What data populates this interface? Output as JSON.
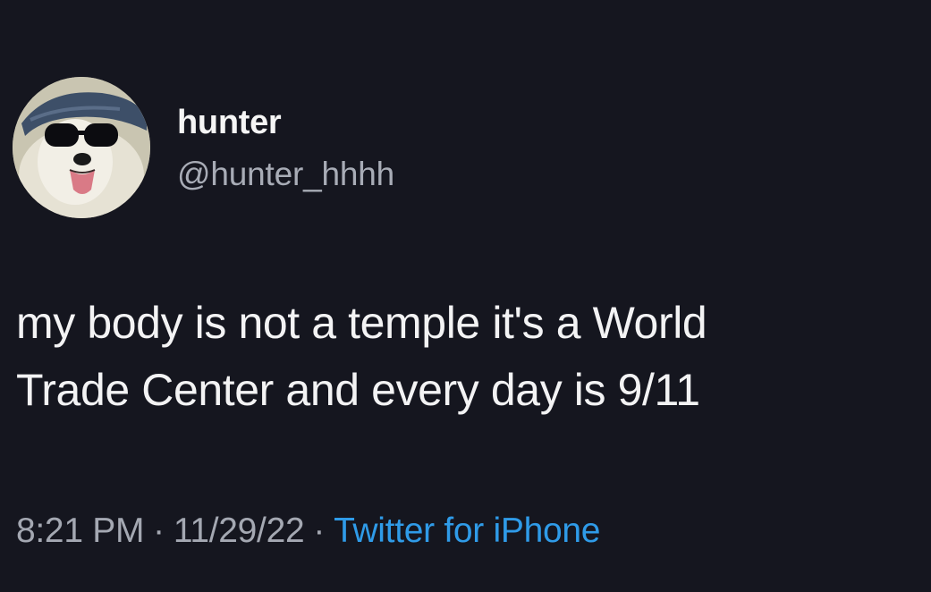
{
  "tweet": {
    "author": {
      "display_name": "hunter",
      "handle": "@hunter_hhhh",
      "avatar": "dog-with-cap-and-sunglasses"
    },
    "text_lines": [
      "my body is not a temple it's a World",
      "Trade Center and every day is 9/11"
    ],
    "meta": {
      "time": "8:21 PM",
      "separator": "·",
      "date": "11/29/22",
      "source": "Twitter for iPhone"
    }
  },
  "colors": {
    "background": "#15161f",
    "text": "#f3f3f4",
    "secondary_text": "#a8acb6",
    "link": "#2f9be8"
  }
}
